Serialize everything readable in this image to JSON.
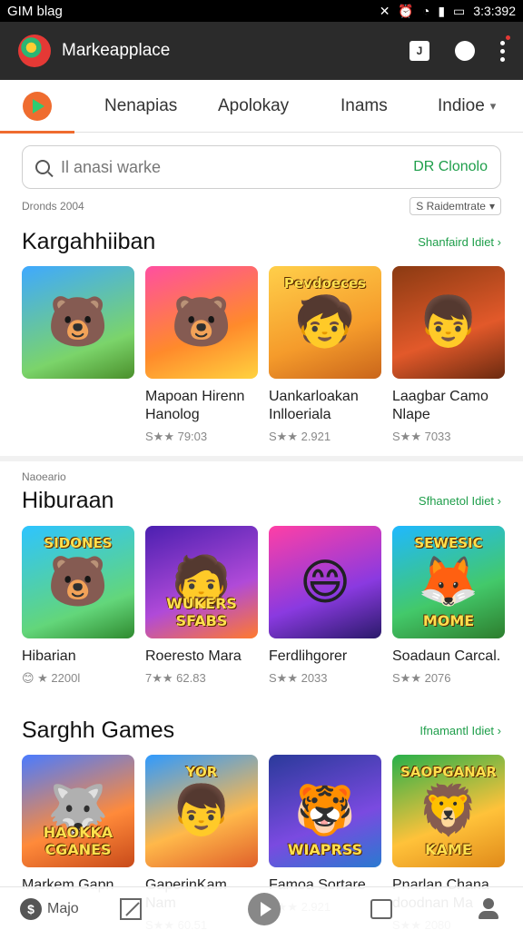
{
  "status_bar": {
    "left_text": "GIM blag",
    "time": "3:3:392",
    "icons": [
      "mute-icon",
      "alarm-icon",
      "wifi-icon",
      "signal-icon",
      "battery-icon"
    ]
  },
  "app_bar": {
    "title": "Markeapplace",
    "action_box_text": "J"
  },
  "tabs": [
    {
      "label": "Nenapias"
    },
    {
      "label": "Apolokay"
    },
    {
      "label": "Inams"
    },
    {
      "label": "Indioe"
    }
  ],
  "search": {
    "placeholder": "Il anasi warke",
    "action": "DR Clonolo"
  },
  "subrow": {
    "label": "Dronds 2004",
    "sort": "S Raidemtrate"
  },
  "sections": [
    {
      "title": "Kargahhiiban",
      "more": "Shanfaird Idiet",
      "cards": [
        {
          "name": "",
          "rating": "",
          "glyph": "🐻",
          "bg": "linear-gradient(160deg,#3fa9ff,#7bd46a 70%,#4a8f2b)"
        },
        {
          "name": "Mapoan Hirenn Hanolog",
          "rating": "S★★ 79:03",
          "glyph": "🐻",
          "bg": "linear-gradient(160deg,#ff4fa0,#ff8a2b 60%,#ffd23f)"
        },
        {
          "name": "Uankarloakan Inlloeriala",
          "rating": "S★★ 2.921",
          "glyph": "🧒",
          "top": "Pevdoeces",
          "bg": "linear-gradient(160deg,#ffcf4a,#f59b2b 60%,#c9651b)"
        },
        {
          "name": "Laagbar Camo Nlape",
          "rating": "S★★ 7033",
          "glyph": "👦",
          "bg": "linear-gradient(160deg,#8a3a12,#e2592a 60%,#6b2a10)"
        }
      ]
    },
    {
      "sub": "Naoeario",
      "title": "Hiburaan",
      "more": "Sfhanetol Idiet",
      "cards": [
        {
          "name": "Hibarian",
          "rating": "😊 ★ 2200l",
          "glyph": "🐻",
          "top": "SIDONES",
          "bg": "linear-gradient(160deg,#2ec4ff,#63d67a 70%,#2f8a2f)"
        },
        {
          "name": "Roeresto Mara",
          "rating": "7★★ 62.83",
          "glyph": "🧑",
          "label": "WUKERS SFABS",
          "bg": "linear-gradient(160deg,#4b1fb0,#b04ad8 60%,#ff7a2e)"
        },
        {
          "name": "Ferdlihgorer",
          "rating": "S★★ 2033",
          "glyph": "😄",
          "bg": "linear-gradient(160deg,#ff3fa5,#8a3ae0 60%,#2a1a6a)"
        },
        {
          "name": "Soadaun Carcal.",
          "rating": "S★★ 2076",
          "glyph": "🦊",
          "top": "SEWESIC",
          "label": "MOME",
          "bg": "linear-gradient(160deg,#1fb8ff,#43c96a 60%,#2d7d2d)"
        }
      ]
    },
    {
      "title": "Sarghh Games",
      "more": "Ifnamantl Idiet",
      "cards": [
        {
          "name": "Markem Gapn",
          "rating": "",
          "glyph": "🐺",
          "label": "HAOKKA CGANES",
          "bg": "linear-gradient(160deg,#4a7bff,#ff8a3a 60%,#c84a1a)"
        },
        {
          "name": "GaperinKam Nam",
          "rating": "S★★ 60.51",
          "glyph": "👦",
          "top": "YOR",
          "bg": "linear-gradient(160deg,#2f9aff,#ffb84a 60%,#e0602a)"
        },
        {
          "name": "Famoa Sortare",
          "rating": "S★★ 2.921",
          "glyph": "🐯",
          "label": "WIAPRSS",
          "bg": "linear-gradient(160deg,#2a3a9a,#7a4ae0 60%,#2a7ad0)"
        },
        {
          "name": "Pnarlan Chana doodnan Ma",
          "rating": "S★★ 2080",
          "glyph": "🦁",
          "top": "SAOPGANAR",
          "label": "KAME",
          "bg": "linear-gradient(160deg,#27b04a,#ffc23a 60%,#e08a1a)"
        }
      ]
    }
  ],
  "bottom_nav": {
    "home_label": "Majo",
    "home_glyph": "$"
  },
  "colors": {
    "accent": "#ef6c2f",
    "link_green": "#1e9e4a",
    "appbar_bg": "#2b2b2b"
  }
}
